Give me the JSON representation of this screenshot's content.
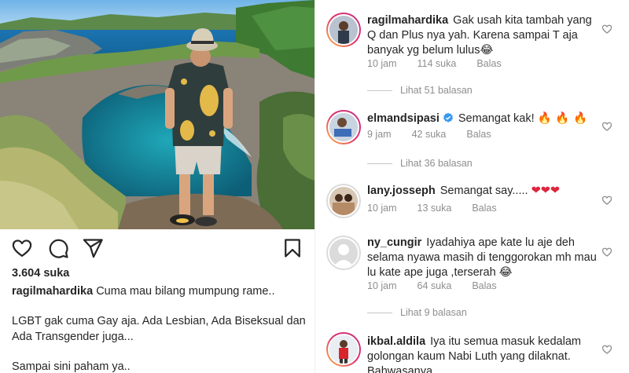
{
  "post": {
    "likes": "3.604 suka",
    "caption_user": "ragilmahardika",
    "caption_first": "Cuma mau bilang mumpung rame..",
    "caption_p2": "LGBT gak cuma Gay aja. Ada Lesbian, Ada Biseksual dan Ada Transgender juga...",
    "caption_p3": "Sampai sini paham ya.."
  },
  "comments": [
    {
      "user": "ragilmahardika",
      "text": "Gak usah kita tambah yang Q dan Plus nya yah. Karena sampai T aja banyak yg belum lulus",
      "emoji": "😂",
      "time": "10 jam",
      "likes": "114 suka",
      "reply": "Balas",
      "view_replies": "Lihat 51 balasan"
    },
    {
      "user": "elmandsipasi",
      "verified": true,
      "text": "Semangat kak!",
      "emoji": "🔥 🔥 🔥",
      "time": "9 jam",
      "likes": "42 suka",
      "reply": "Balas",
      "view_replies": "Lihat 36 balasan"
    },
    {
      "user": "lany.josseph",
      "text": "Semangat say.....",
      "emoji": "❤❤❤",
      "time": "10 jam",
      "likes": "13 suka",
      "reply": "Balas"
    },
    {
      "user": "ny_cungir",
      "text": "Iyadahiya ape kate lu aje deh selama nyawa masih di tenggorokan mh mau lu kate ape juga ,terserah",
      "emoji": "😂",
      "time": "10 jam",
      "likes": "64 suka",
      "reply": "Balas",
      "view_replies": "Lihat 9 balasan"
    },
    {
      "user": "ikbal.aldila",
      "text": "Iya itu semua masuk kedalam golongan kaum Nabi Luth yang dilaknat.",
      "partial": "Bahwasanya"
    }
  ],
  "icons": {
    "like": "heart-outline-icon",
    "comment": "speech-bubble-icon",
    "share": "paper-plane-icon",
    "save": "bookmark-icon",
    "comment_like": "small-heart-icon",
    "verified": "verified-badge-icon"
  },
  "colors": {
    "text": "#262626",
    "muted": "#8e8e8e",
    "verified": "#3897f0",
    "story_ring_start": "#f9c04a",
    "story_ring_end": "#c13584"
  }
}
